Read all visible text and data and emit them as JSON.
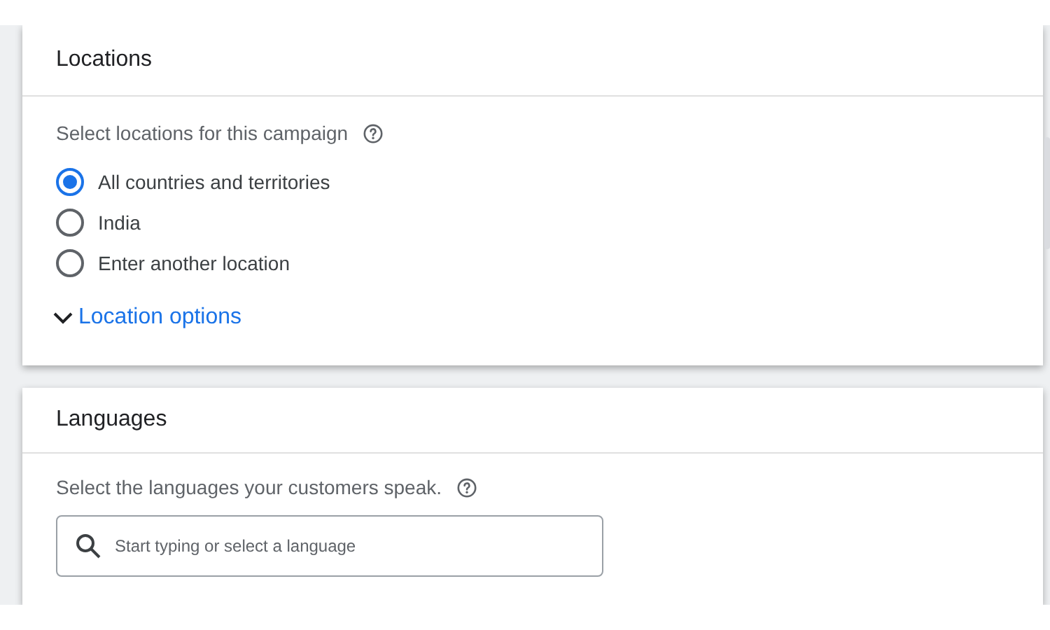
{
  "locations": {
    "title": "Locations",
    "prompt": "Select locations for this campaign",
    "options": [
      {
        "label": "All countries and territories",
        "selected": true
      },
      {
        "label": "India",
        "selected": false
      },
      {
        "label": "Enter another location",
        "selected": false
      }
    ],
    "more_link": "Location options"
  },
  "languages": {
    "title": "Languages",
    "prompt": "Select the languages your customers speak.",
    "search": {
      "placeholder": "Start typing or select a language"
    }
  }
}
